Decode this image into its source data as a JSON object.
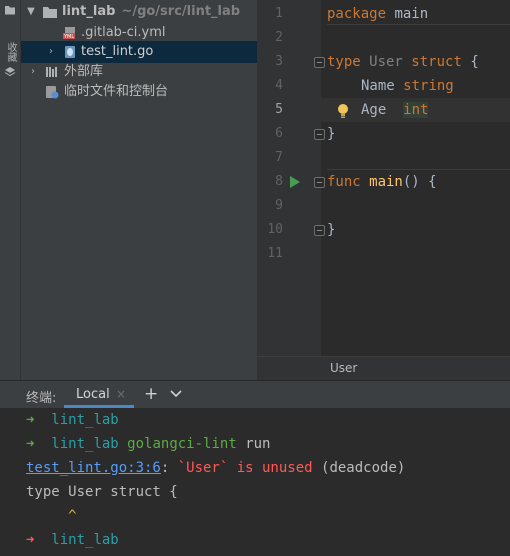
{
  "sidebar_stripe": {
    "tab_label": "收藏",
    "icons": [
      "folder-icon",
      "structure-icon"
    ]
  },
  "project": {
    "root": {
      "name": "lint_lab",
      "path": "~/go/src/lint_lab"
    },
    "items": [
      {
        "label": ".gitlab-ci.yml",
        "icon": "yml-file-icon"
      },
      {
        "label": "test_lint.go",
        "icon": "go-file-icon",
        "selected": true
      },
      {
        "label": "外部库",
        "icon": "library-icon"
      },
      {
        "label": "临时文件和控制台",
        "icon": "scratch-icon"
      }
    ]
  },
  "editor": {
    "line_numbers": [
      "1",
      "2",
      "3",
      "4",
      "5",
      "6",
      "7",
      "8",
      "9",
      "10",
      "11"
    ],
    "lines": {
      "l1": {
        "kw": "package",
        "rest": " main"
      },
      "l3": {
        "kw": "type",
        "name": " User",
        "kw2": " struct",
        "rest": " {"
      },
      "l4": {
        "field": "Name",
        "type": "string"
      },
      "l5": {
        "field": "Age",
        "type": "int"
      },
      "l6": {
        "rest": "}"
      },
      "l8": {
        "kw": "func",
        "fn": " main",
        "rest": "() {"
      },
      "l10": {
        "rest": "}"
      }
    },
    "breadcrumb": "User"
  },
  "terminal": {
    "title": "终端:",
    "tab": "Local",
    "add": "+",
    "prompt_arrow": "➜",
    "cwd": "lint_lab",
    "cmd1": "golangci-lint",
    "cmd1_arg": "run",
    "issue_location": "test_lint.go:3:6",
    "issue_message": "`User` is unused",
    "issue_linter": "(deadcode)",
    "source_line": "type User struct {",
    "caret": "^"
  },
  "colors": {
    "editor_bg": "#2b2b2b",
    "panel_bg": "#3c3f41",
    "keyword": "#cc7832",
    "selection": "#0d293e",
    "error_red": "#ff5a55",
    "prompt_green": "#5faa46",
    "run_green": "#499c54",
    "link_blue": "#589df6"
  }
}
